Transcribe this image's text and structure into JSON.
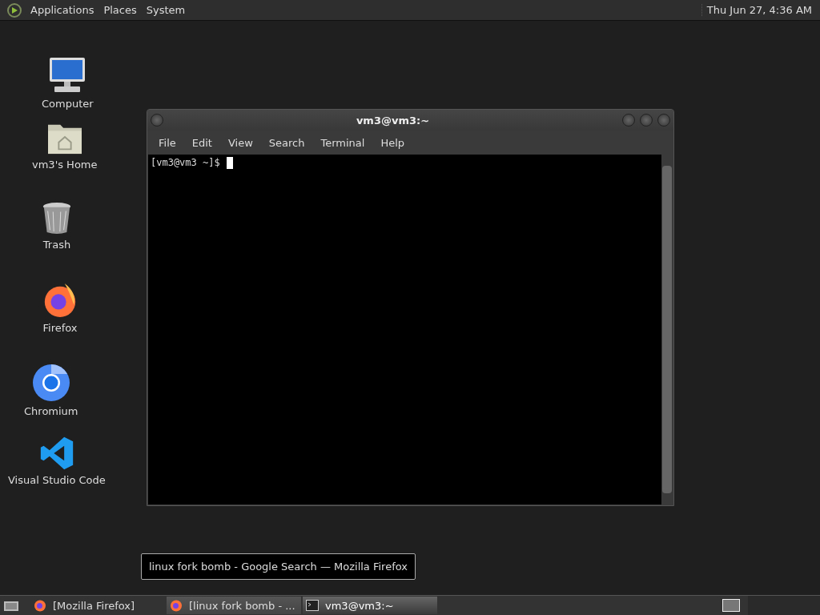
{
  "top_panel": {
    "menus": [
      "Applications",
      "Places",
      "System"
    ],
    "clock": "Thu Jun 27,  4:36 AM"
  },
  "desktop_icons": [
    {
      "kind": "computer",
      "label": "Computer"
    },
    {
      "kind": "home",
      "label": "vm3's Home"
    },
    {
      "kind": "trash",
      "label": "Trash"
    },
    {
      "kind": "firefox",
      "label": "Firefox"
    },
    {
      "kind": "chromium",
      "label": "Chromium"
    },
    {
      "kind": "vscode",
      "label": "Visual Studio Code"
    }
  ],
  "terminal_window": {
    "title": "vm3@vm3:~",
    "menu": [
      "File",
      "Edit",
      "View",
      "Search",
      "Terminal",
      "Help"
    ],
    "prompt": "[vm3@vm3 ~]$"
  },
  "tooltip": "linux fork bomb - Google Search — Mozilla Firefox",
  "taskbar": {
    "tasks": [
      {
        "kind": "firefox",
        "label": "[Mozilla Firefox]",
        "selected": false,
        "hovered": false
      },
      {
        "kind": "firefox",
        "label": "[linux fork bomb - ...",
        "selected": false,
        "hovered": true
      },
      {
        "kind": "terminal",
        "label": "vm3@vm3:~",
        "selected": true,
        "hovered": false
      }
    ]
  }
}
